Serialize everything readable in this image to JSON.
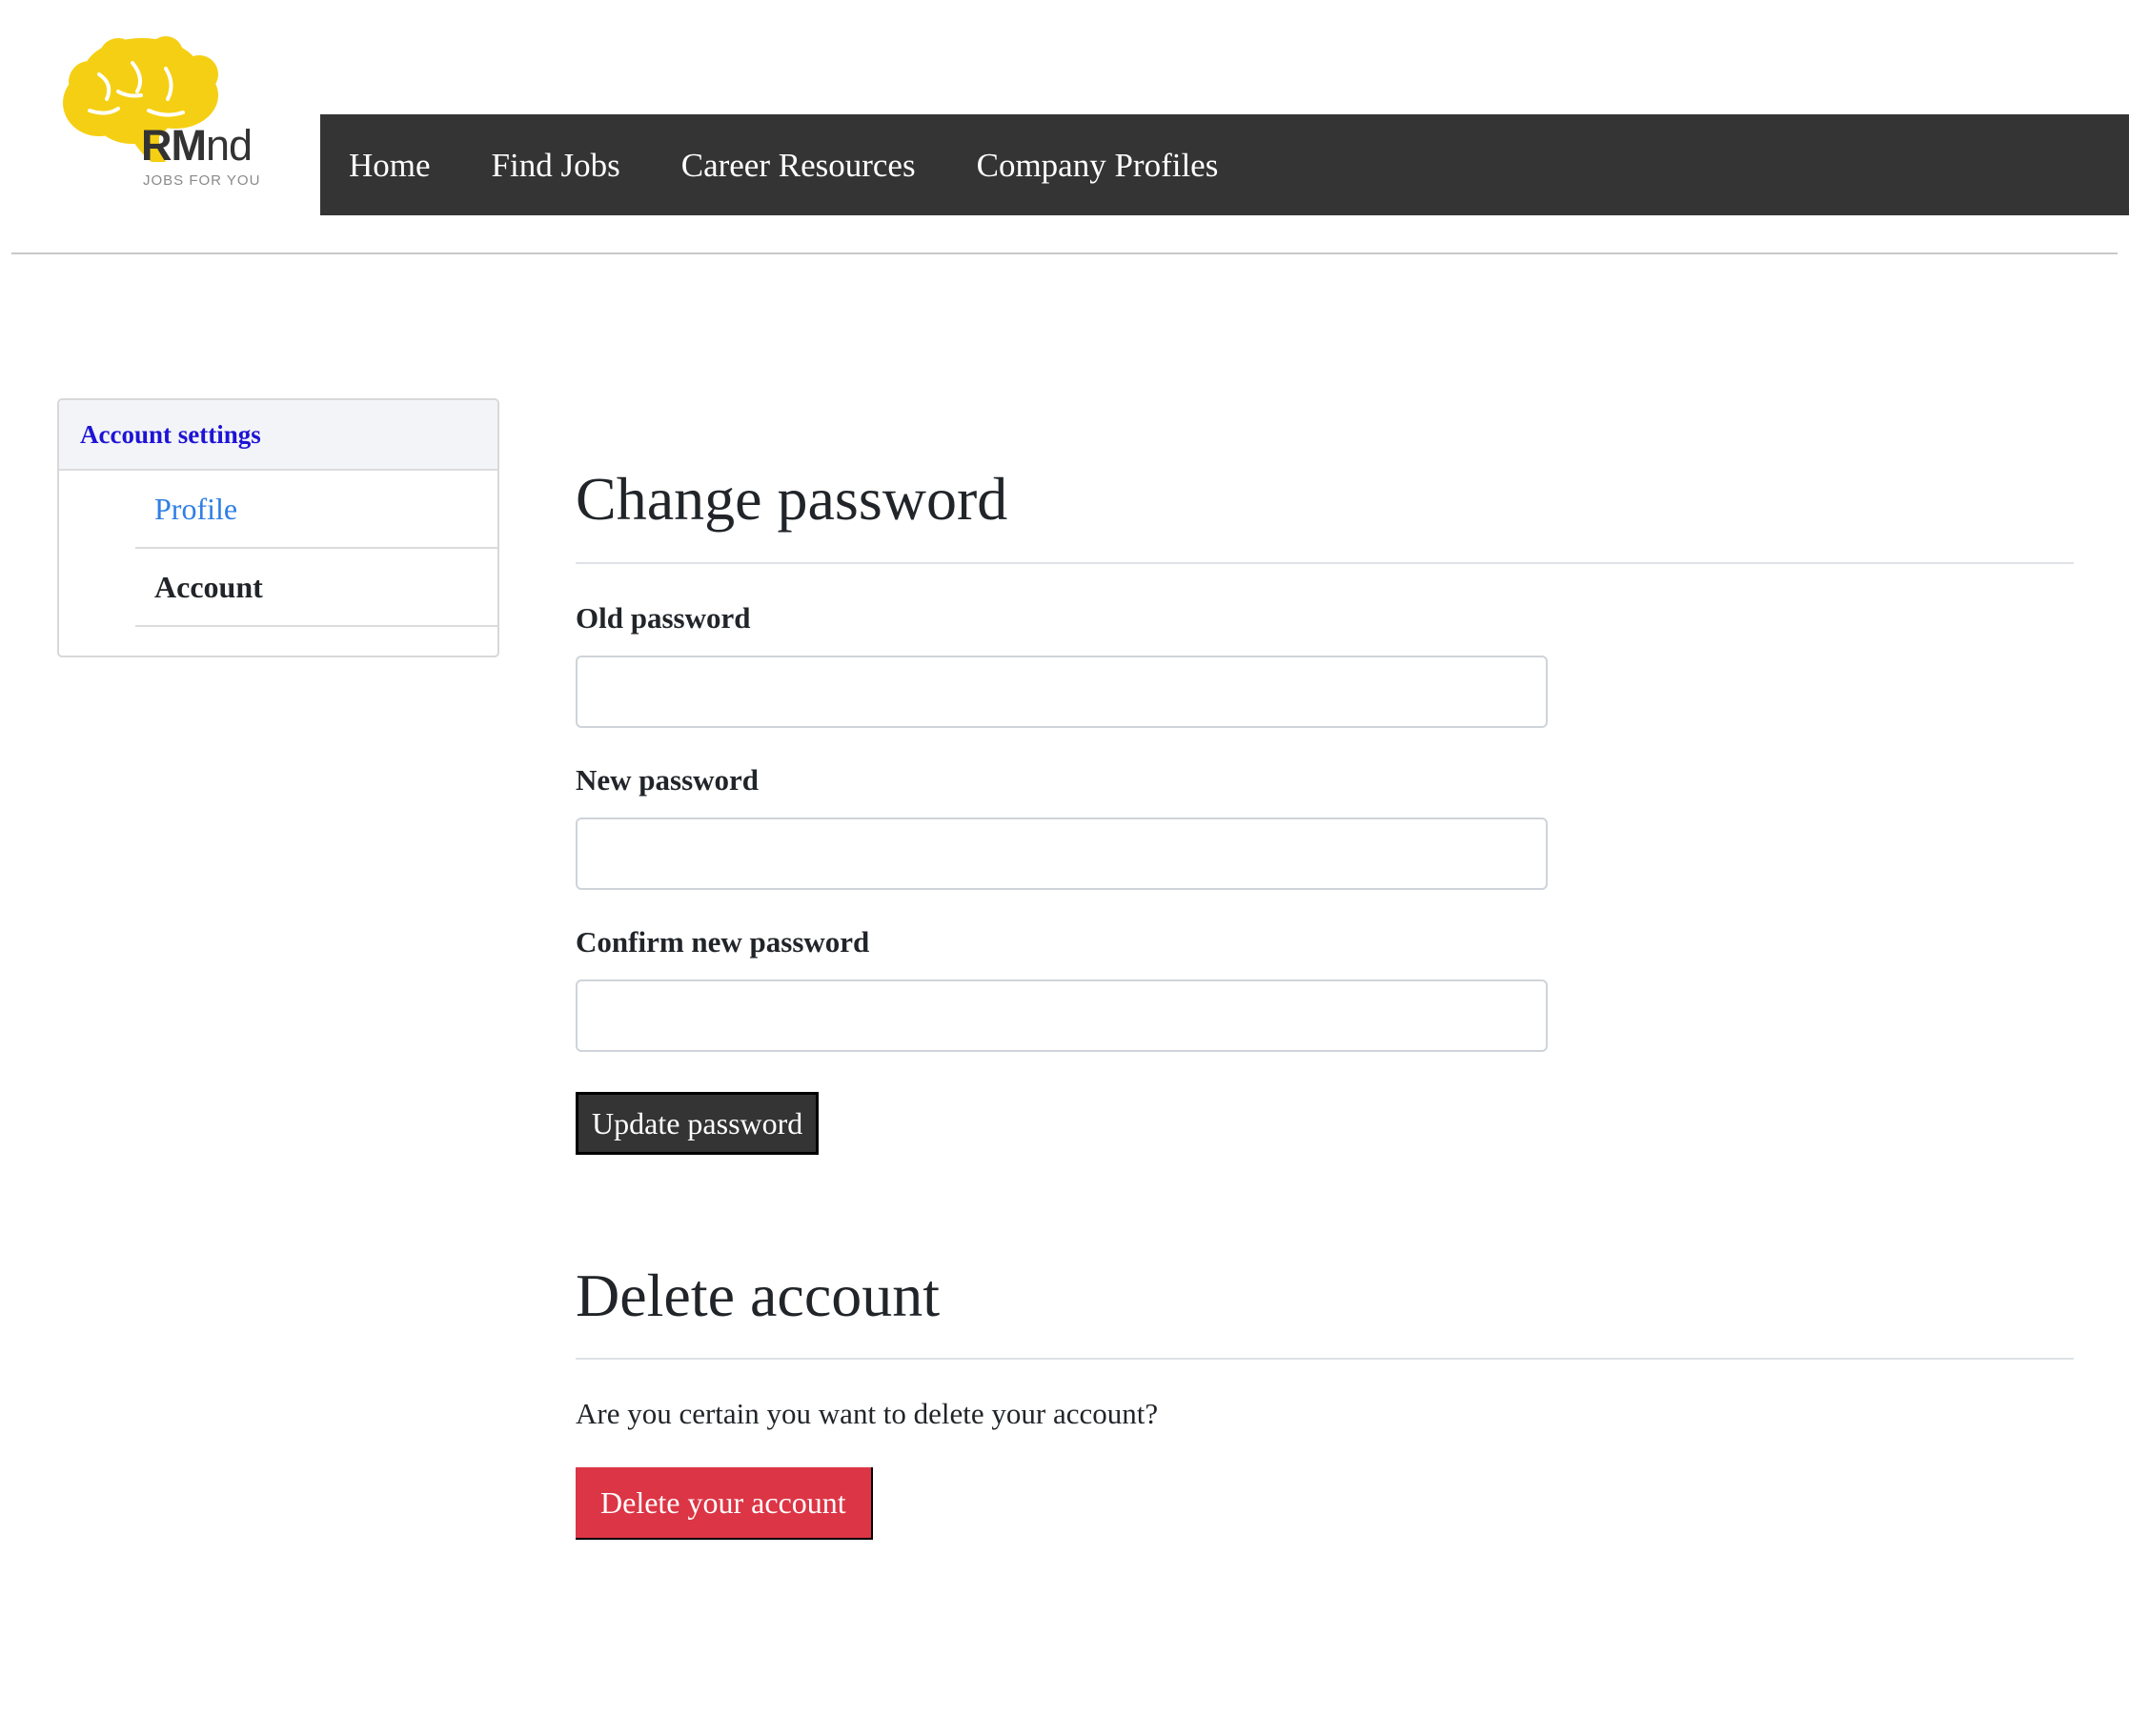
{
  "brand": {
    "name_bold": "RM",
    "name_rest": "nd",
    "tagline": "JOBS FOR YOU",
    "logo_color": "#f5cf13"
  },
  "nav": {
    "items": [
      {
        "label": "Home"
      },
      {
        "label": "Find Jobs"
      },
      {
        "label": "Career Resources"
      },
      {
        "label": "Company Profiles"
      }
    ],
    "background": "#343434"
  },
  "sidebar": {
    "heading": "Account settings",
    "items": [
      {
        "label": "Profile",
        "state": "link"
      },
      {
        "label": "Account",
        "state": "active"
      }
    ]
  },
  "change_password": {
    "title": "Change password",
    "old_label": "Old password",
    "old_value": "",
    "new_label": "New password",
    "new_value": "",
    "confirm_label": "Confirm new password",
    "confirm_value": "",
    "submit_label": "Update password"
  },
  "delete_account": {
    "title": "Delete account",
    "prompt": "Are you certain you want to delete your account?",
    "button_label": "Delete your account",
    "button_color": "#dc3545"
  }
}
